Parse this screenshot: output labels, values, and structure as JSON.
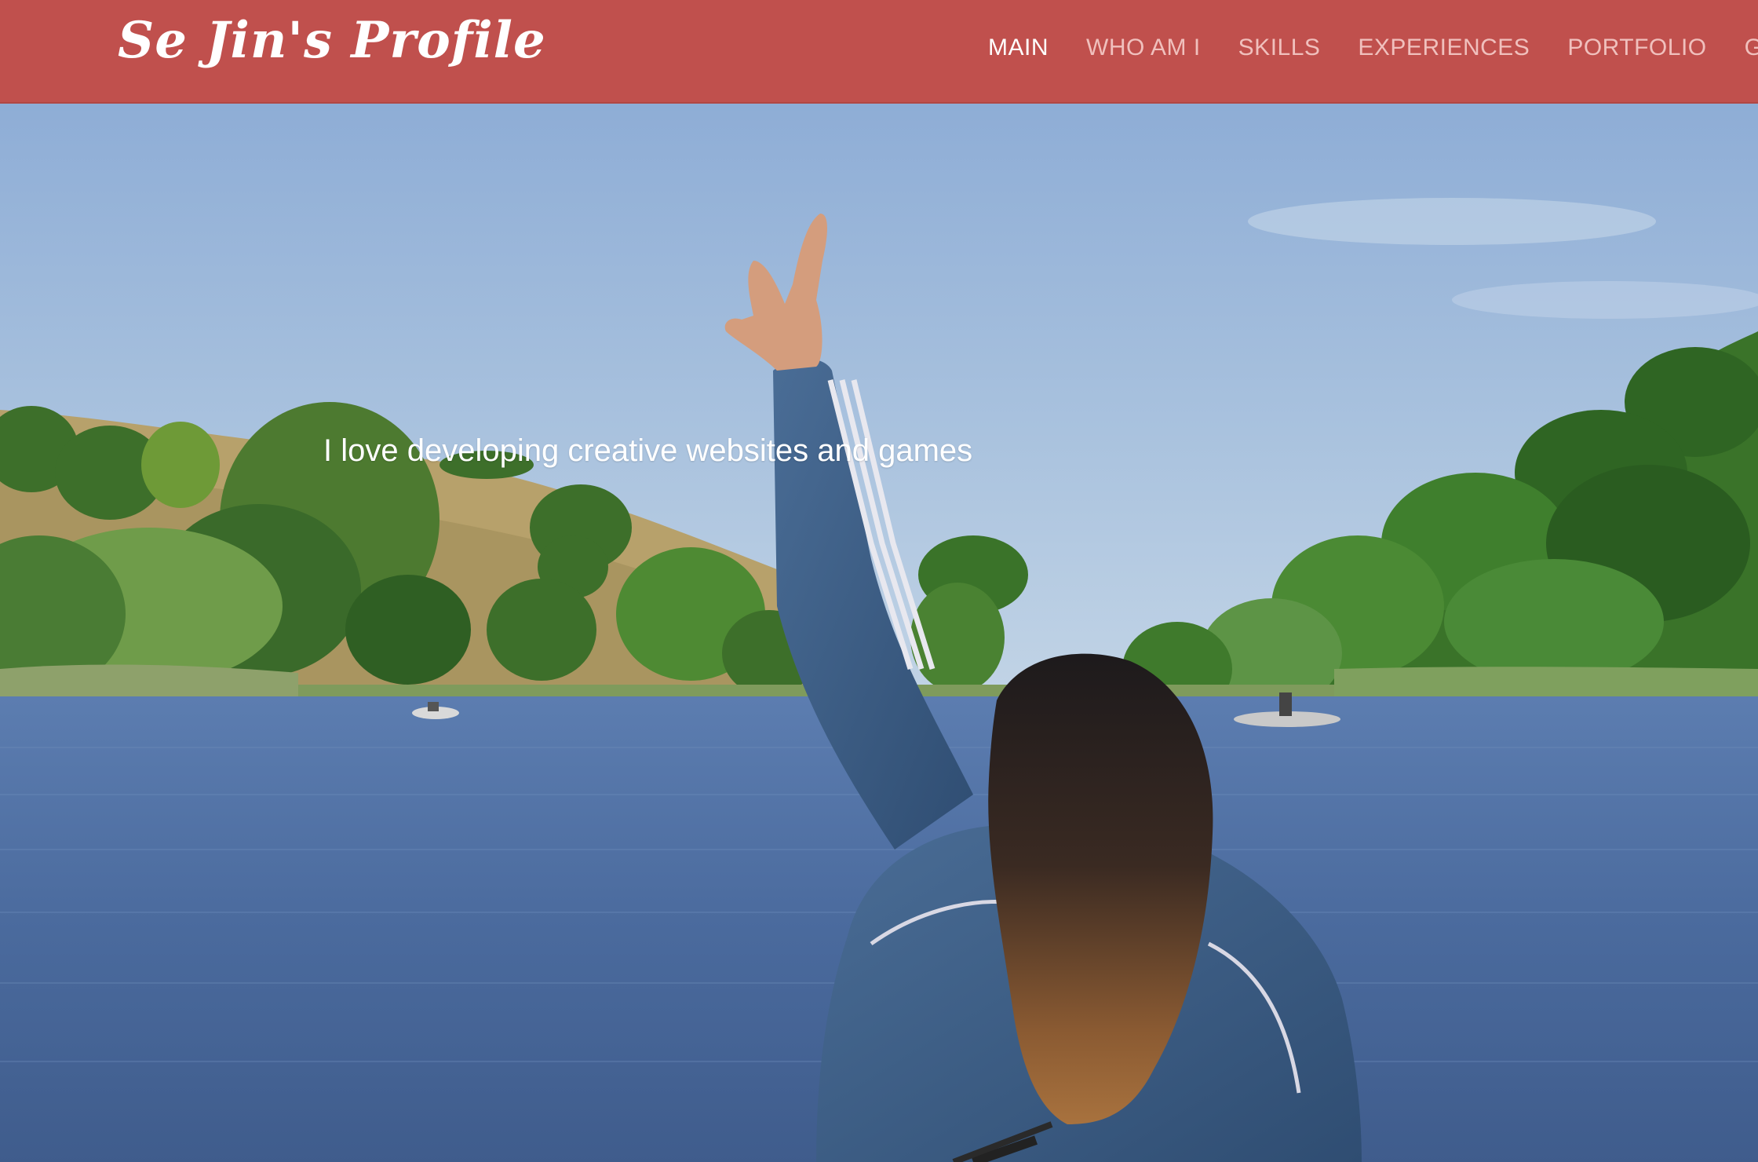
{
  "site": {
    "brand": "Se Jin's Profile"
  },
  "nav": {
    "items": [
      {
        "label": "MAIN",
        "active": true
      },
      {
        "label": "WHO AM I",
        "active": false
      },
      {
        "label": "SKILLS",
        "active": false
      },
      {
        "label": "EXPERIENCES",
        "active": false
      },
      {
        "label": "PORTFOLIO",
        "active": false
      },
      {
        "label": "GET IN TOUCH",
        "active": false
      }
    ]
  },
  "hero": {
    "tagline": "I love developing creative websites and games"
  },
  "colors": {
    "navbar": "#c0504d",
    "nav_active": "#ffffff",
    "nav_inactive": "#f0c0bd",
    "sky": "#9bb6d8",
    "lake": "#4f6f9c",
    "hills": "#3f7a2c",
    "jacket": "#3e5f85"
  },
  "icons": {
    "hero_image": "person-peace-sign-lake-photo"
  }
}
